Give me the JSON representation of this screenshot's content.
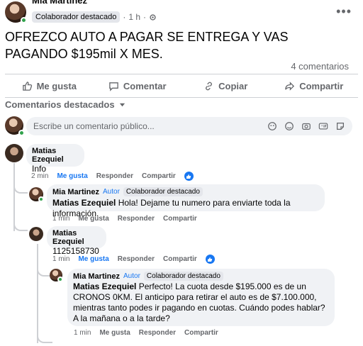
{
  "post": {
    "author": "Mia Martinez",
    "badge": "Colaborador destacado",
    "time": "1 h",
    "text": "OFREZCO AUTO A PAGAR SE ENTREGA Y VAS PAGANDO $195mil X MES.",
    "comments_count": "4 comentarios"
  },
  "actions": {
    "like": "Me gusta",
    "comment": "Comentar",
    "copy": "Copiar",
    "share": "Compartir"
  },
  "featured_label": "Comentarios destacados",
  "comment_input": {
    "placeholder": "Escribe un comentario público..."
  },
  "comment_labels": {
    "like": "Me gusta",
    "reply": "Responder",
    "share": "Compartir"
  },
  "comments": [
    {
      "author": "Matias Ezequiel",
      "text": "Info",
      "time": "2 min"
    },
    {
      "author": "Mia Martinez",
      "author_tag": "Autor",
      "badge": "Colaborador destacado",
      "mention": "Matias Ezequiel",
      "text": "Hola! Dejame tu numero para enviarte toda la información.",
      "time": "1 min"
    },
    {
      "author": "Matias Ezequiel",
      "text": "1125158730",
      "time": "1 min"
    },
    {
      "author": "Mia Martinez",
      "author_tag": "Autor",
      "badge": "Colaborador destacado",
      "mention": "Matias Ezequiel",
      "text": "Perfecto! La cuota desde $195.000 es de un CRONOS 0KM. El anticipo para retirar el auto es de $7.100.000, mientras tanto podes ir pagando en cuotas. Cuándo podes hablar? A la mañana o a la tarde?",
      "time": "1 min"
    }
  ],
  "colors": {
    "accent": "#1877f2",
    "online": "#31a24c"
  }
}
